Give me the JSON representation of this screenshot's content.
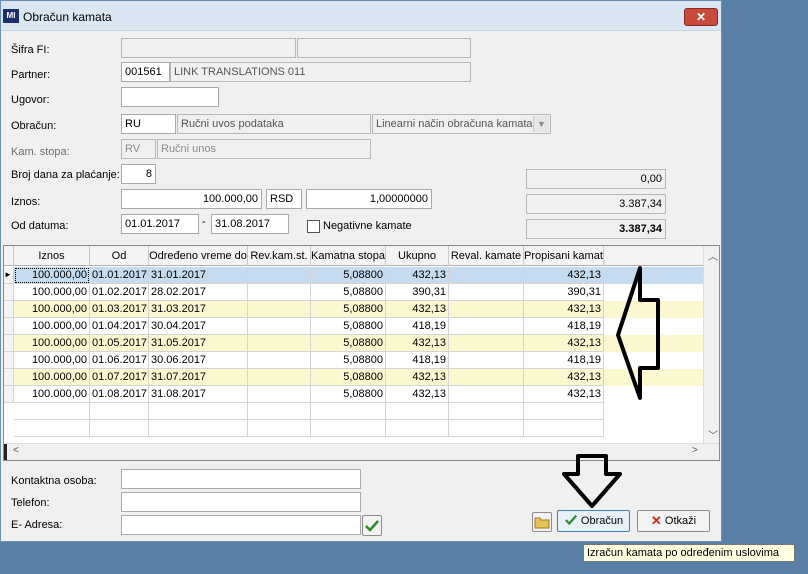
{
  "window": {
    "title": "Obračun kamata",
    "app_icon": "MI",
    "close_label": "✕"
  },
  "form": {
    "sifra_fi_label": "Šifra FI:",
    "sifra_fi_1": "",
    "sifra_fi_2": "",
    "partner_label": "Partner:",
    "partner_code": "001561",
    "partner_name": "LINK TRANSLATIONS 011",
    "ugovor_label": "Ugovor:",
    "ugovor_value": "",
    "obracun_label": "Obračun:",
    "obracun_code": "RU",
    "obracun_desc": "Ručni uvos podataka",
    "obracun_method": "Linearni način obračuna kamata",
    "kam_stopa_label": "Kam. stopa:",
    "kam_stopa_code": "RV",
    "kam_stopa_desc": "Ručni unos",
    "broj_dana_label": "Broj dana za plaćanje:",
    "broj_dana_value": "8",
    "iznos_label": "Iznos:",
    "iznos_value": "100.000,00",
    "currency": "RSD",
    "rate": "1,00000000",
    "od_datuma_label": "Od datuma:",
    "date_from": "01.01.2017",
    "date_sep": "-",
    "date_to": "31.08.2017",
    "negativne_label": "Negativne kamate",
    "negativne_checked": false,
    "sum1": "0,00",
    "sum2": "3.387,34",
    "sum3": "3.387,34"
  },
  "grid": {
    "columns": [
      "Iznos",
      "Od",
      "Određeno vreme do",
      "Rev.kam.st.",
      "Kamatna stopa",
      "Ukupno",
      "Reval. kamate",
      "Propisani kamati"
    ],
    "rows": [
      [
        "100.000,00",
        "01.01.2017",
        "31.01.2017",
        "",
        "5,08800",
        "432,13",
        "",
        "432,13"
      ],
      [
        "100.000,00",
        "01.02.2017",
        "28.02.2017",
        "",
        "5,08800",
        "390,31",
        "",
        "390,31"
      ],
      [
        "100.000,00",
        "01.03.2017",
        "31.03.2017",
        "",
        "5,08800",
        "432,13",
        "",
        "432,13"
      ],
      [
        "100.000,00",
        "01.04.2017",
        "30.04.2017",
        "",
        "5,08800",
        "418,19",
        "",
        "418,19"
      ],
      [
        "100.000,00",
        "01.05.2017",
        "31.05.2017",
        "",
        "5,08800",
        "432,13",
        "",
        "432,13"
      ],
      [
        "100.000,00",
        "01.06.2017",
        "30.06.2017",
        "",
        "5,08800",
        "418,19",
        "",
        "418,19"
      ],
      [
        "100.000,00",
        "01.07.2017",
        "31.07.2017",
        "",
        "5,08800",
        "432,13",
        "",
        "432,13"
      ],
      [
        "100.000,00",
        "01.08.2017",
        "31.08.2017",
        "",
        "5,08800",
        "432,13",
        "",
        "432,13"
      ]
    ],
    "selected_row": 0,
    "row_indicator": "►"
  },
  "contact": {
    "kontakt_label": "Kontaktna osoba:",
    "kontakt_value": "",
    "telefon_label": "Telefon:",
    "telefon_value": "",
    "email_label": "E- Adresa:",
    "email_value": ""
  },
  "buttons": {
    "obracun_label": "Obračun",
    "otkazi_label": "Otkaži",
    "check_icon": "check-icon",
    "folder_icon": "folder-icon"
  },
  "tooltip": "Izračun kamata po određenim uslovima",
  "colors": {
    "row_alt": "#fbf7cf",
    "row_selected": "#c5dcf0",
    "window_bg": "#f0f0f0",
    "desktop": "#5b80a8"
  }
}
